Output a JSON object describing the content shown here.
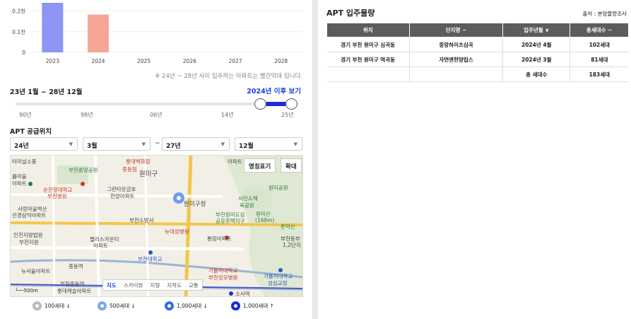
{
  "chart_data": {
    "type": "bar",
    "categories": [
      "2023",
      "2024",
      "2025",
      "2026",
      "2027",
      "2028"
    ],
    "values": [
      0.24,
      0.183,
      0,
      0,
      0,
      0
    ],
    "tick_labels": [
      "0",
      "0.1천",
      "0.2천"
    ],
    "ylim": [
      0,
      0.24
    ],
    "colors": [
      "#8d95f5",
      "#f5a694"
    ],
    "note": "※ 24년 ~ 28년 사이 입주하는 아파트는 빨간막대 입니다."
  },
  "range": {
    "title": "23년 1월 ~ 28년 12월",
    "link": "2024년 이후 보기",
    "ticks": [
      "90년",
      "98년",
      "06년",
      "14년",
      "25년"
    ],
    "start_fraction": 0.86,
    "end_fraction": 1.0
  },
  "supply": {
    "title": "APT 공급위치",
    "selects": [
      "24년",
      "3월",
      "27년",
      "12월"
    ],
    "tilde": "~"
  },
  "map": {
    "buttons": [
      "명칭표기",
      "확대"
    ],
    "types": [
      "지도",
      "스카이뷰",
      "지형",
      "지적도",
      "교통"
    ],
    "scale": "500m",
    "labels": [
      {
        "text": "터미널소풍",
        "c": ""
      },
      {
        "text": "부천중앙공원",
        "c": "green"
      },
      {
        "text": "롯데백화점",
        "c": "red"
      },
      {
        "text": "중동점",
        "c": "red"
      },
      {
        "text": "원미구",
        "c": ""
      },
      {
        "text": "아파트",
        "c": ""
      },
      {
        "text": "를마을",
        "c": ""
      },
      {
        "text": "아파트",
        "c": ""
      },
      {
        "text": "순천향대학교",
        "c": "red"
      },
      {
        "text": "부천병원",
        "c": "red"
      },
      {
        "text": "그린타운금호",
        "c": ""
      },
      {
        "text": "한양아파트",
        "c": ""
      },
      {
        "text": "원미구청",
        "c": ""
      },
      {
        "text": "시민소체",
        "c": "green"
      },
      {
        "text": "육공원",
        "c": "green"
      },
      {
        "text": "원미공원",
        "c": "green"
      },
      {
        "text": "사랑마을벽산",
        "c": ""
      },
      {
        "text": "선경삼익아파트",
        "c": ""
      },
      {
        "text": "부천소방서",
        "c": ""
      },
      {
        "text": "부천원미도심",
        "c": "green"
      },
      {
        "text": "공유주택지구",
        "c": "green"
      },
      {
        "text": "원미산",
        "c": "green"
      },
      {
        "text": "(168m)",
        "c": "green"
      },
      {
        "text": "인천지방법원",
        "c": ""
      },
      {
        "text": "부천지원",
        "c": ""
      },
      {
        "text": "뉴대성병원",
        "c": "red"
      },
      {
        "text": "팰리스카운티",
        "c": ""
      },
      {
        "text": "아파트",
        "c": ""
      },
      {
        "text": "롱림아파트",
        "c": ""
      },
      {
        "text": "춘덕산",
        "c": "green"
      },
      {
        "text": "부천동부",
        "c": ""
      },
      {
        "text": "1,2단지",
        "c": ""
      },
      {
        "text": "부천대학교",
        "c": "blue"
      },
      {
        "text": "중동역",
        "c": ""
      },
      {
        "text": "뉴서울아파트",
        "c": ""
      },
      {
        "text": "가톨릭대학교",
        "c": "red"
      },
      {
        "text": "부천성모병원",
        "c": "red"
      },
      {
        "text": "가톨릭대학교",
        "c": "blue"
      },
      {
        "text": "성심교정",
        "c": "blue"
      },
      {
        "text": "부천중동역",
        "c": ""
      },
      {
        "text": "롯데캐슬아파트",
        "c": ""
      },
      {
        "text": "소사역",
        "c": ""
      }
    ]
  },
  "legend": [
    {
      "label": "100세대 ↓",
      "color": "#b9b9c2"
    },
    {
      "label": "500세대 ↓",
      "color": "#7da7f0"
    },
    {
      "label": "1,000세대 ↓",
      "color": "#2f6fe8"
    },
    {
      "label": "1,000세대 ↑",
      "color": "#1a2bdc"
    }
  ],
  "right": {
    "title": "APT 입주물량",
    "source": "출처 : 분양물량조사",
    "headers": [
      "위치",
      "단지명 −",
      "입주년월 ∨",
      "총세대수 −"
    ],
    "rows": [
      [
        "경기 부천 원미구 심곡동",
        "중앙하이츠심곡",
        "2024년 4월",
        "102세대"
      ],
      [
        "경기 부천 원미구 역곡동",
        "자연앤한양립스",
        "2024년 3월",
        "81세대"
      ],
      [
        "",
        "",
        "총 세대수",
        "183세대"
      ]
    ]
  }
}
